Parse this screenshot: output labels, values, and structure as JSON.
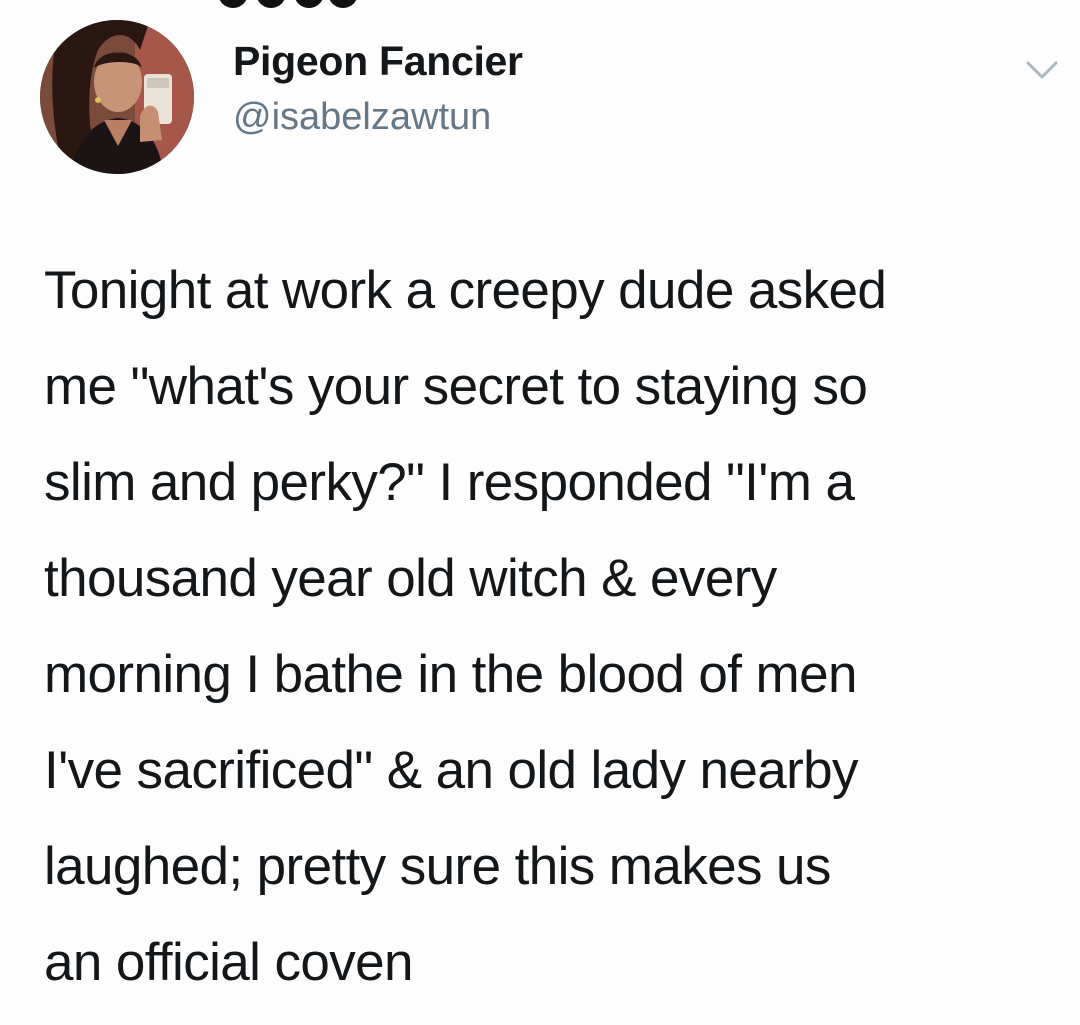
{
  "author": {
    "display_name": "Pigeon Fancier",
    "handle": "@isabelzawtun",
    "avatar_icon": "profile-photo"
  },
  "menu": {
    "icon": "chevron-down-icon",
    "color": "#aab8c2"
  },
  "tweet": {
    "lines": [
      "Tonight at work a creepy dude asked",
      "me \"what's your secret to staying so",
      "slim and perky?\" I responded \"I'm a",
      "thousand year old witch & every",
      "morning I bathe in the blood of men",
      "I've sacrificed\" & an old lady nearby",
      "laughed; pretty sure this makes us",
      "an official coven"
    ]
  },
  "colors": {
    "text": "#14171a",
    "secondary": "#657786",
    "background": "#fdfdfd"
  }
}
